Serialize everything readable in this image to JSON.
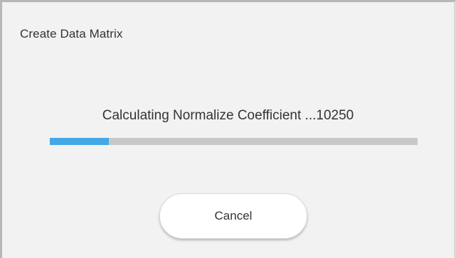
{
  "window": {
    "title": "Create Data Matrix"
  },
  "progress": {
    "status_text": "Calculating Normalize Coefficient ...10250",
    "fraction": 0.16,
    "fill_color": "#43a8e6",
    "track_color": "#c8c8c8"
  },
  "actions": {
    "cancel_label": "Cancel"
  }
}
